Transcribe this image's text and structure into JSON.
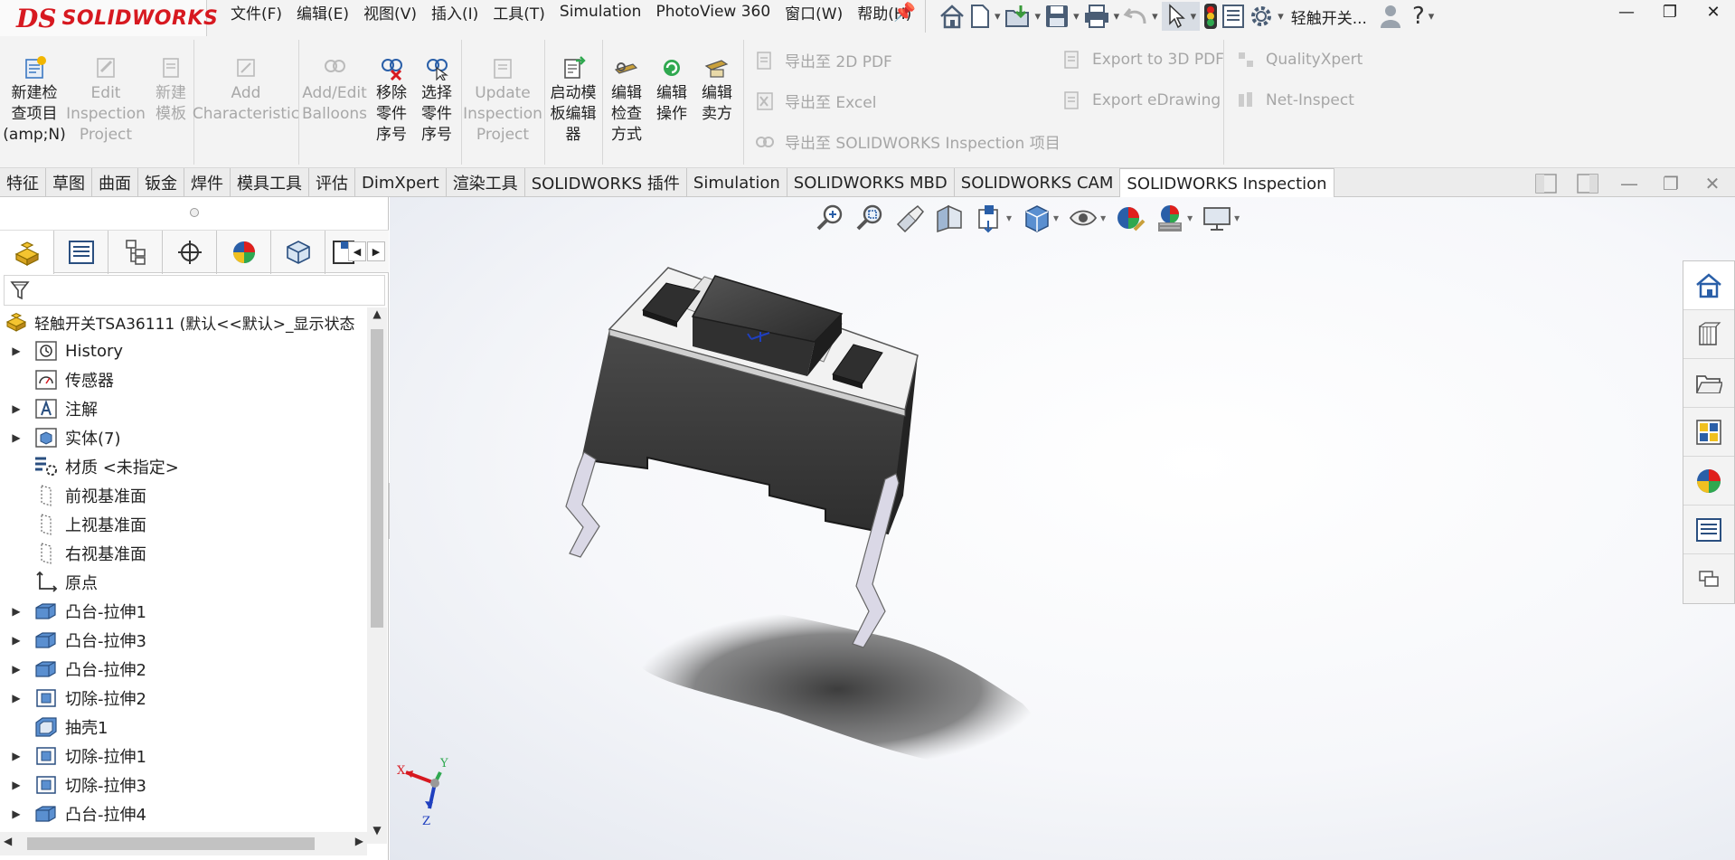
{
  "app": {
    "logo_prefix": "DS",
    "logo_text": "SOLIDWORKS"
  },
  "menu": [
    "文件(F)",
    "编辑(E)",
    "视图(V)",
    "插入(I)",
    "工具(T)",
    "Simulation",
    "PhotoView 360",
    "窗口(W)",
    "帮助(H)"
  ],
  "quick_access": {
    "doc_title": "轻触开关..."
  },
  "ribbon": {
    "buttons": [
      {
        "label": "新建检\n查项目\n(amp;N)",
        "enabled": true
      },
      {
        "label": "Edit\nInspection\nProject",
        "enabled": false
      },
      {
        "label": "新建\n模板",
        "enabled": false
      },
      {
        "label": "Add\nCharacteristic",
        "enabled": false
      },
      {
        "label": "Add/Edit\nBalloons",
        "enabled": false
      },
      {
        "label": "移除\n零件\n序号",
        "enabled": true
      },
      {
        "label": "选择\n零件\n序号",
        "enabled": true
      },
      {
        "label": "Update\nInspection\nProject",
        "enabled": false
      },
      {
        "label": "启动模\n板编辑\n器",
        "enabled": true
      },
      {
        "label": "编辑\n检查\n方式",
        "enabled": true
      },
      {
        "label": "编辑\n操作",
        "enabled": true
      },
      {
        "label": "编辑\n卖方",
        "enabled": true
      }
    ],
    "exports": [
      "导出至 2D PDF",
      "导出至 Excel",
      "导出至 SOLIDWORKS Inspection 项目",
      "Export to 3D PDF",
      "Export eDrawing",
      "QualityXpert",
      "Net-Inspect"
    ]
  },
  "tabs": {
    "items": [
      "特征",
      "草图",
      "曲面",
      "钣金",
      "焊件",
      "模具工具",
      "评估",
      "DimXpert",
      "渲染工具",
      "SOLIDWORKS 插件",
      "Simulation",
      "SOLIDWORKS MBD",
      "SOLIDWORKS CAM",
      "SOLIDWORKS Inspection"
    ],
    "active": "SOLIDWORKS Inspection"
  },
  "feature_tree": {
    "root": "轻触开关TSA36111 (默认<<默认>_显示状态",
    "nodes": [
      {
        "label": "History",
        "expandable": true,
        "icon": "history-icon"
      },
      {
        "label": "传感器",
        "expandable": false,
        "icon": "sensor-icon"
      },
      {
        "label": "注解",
        "expandable": true,
        "icon": "annotation-icon"
      },
      {
        "label": "实体(7)",
        "expandable": true,
        "icon": "solid-bodies-icon"
      },
      {
        "label": "材质 <未指定>",
        "expandable": false,
        "icon": "material-icon"
      },
      {
        "label": "前视基准面",
        "expandable": false,
        "icon": "plane-icon"
      },
      {
        "label": "上视基准面",
        "expandable": false,
        "icon": "plane-icon"
      },
      {
        "label": "右视基准面",
        "expandable": false,
        "icon": "plane-icon"
      },
      {
        "label": "原点",
        "expandable": false,
        "icon": "origin-icon"
      },
      {
        "label": "凸台-拉伸1",
        "expandable": true,
        "icon": "boss-extrude-icon"
      },
      {
        "label": "凸台-拉伸3",
        "expandable": true,
        "icon": "boss-extrude-icon"
      },
      {
        "label": "凸台-拉伸2",
        "expandable": true,
        "icon": "boss-extrude-icon"
      },
      {
        "label": "切除-拉伸2",
        "expandable": true,
        "icon": "cut-extrude-icon"
      },
      {
        "label": "抽壳1",
        "expandable": false,
        "icon": "shell-icon"
      },
      {
        "label": "切除-拉伸1",
        "expandable": true,
        "icon": "cut-extrude-icon"
      },
      {
        "label": "切除-拉伸3",
        "expandable": true,
        "icon": "cut-extrude-icon"
      },
      {
        "label": "凸台-拉伸4",
        "expandable": true,
        "icon": "boss-extrude-icon"
      }
    ]
  },
  "triad": {
    "x": "X",
    "y": "Y",
    "z": "Z"
  },
  "colors": {
    "brand": "#d71920",
    "body": "#3f3f3f",
    "top": "#f2f2f2",
    "accent": "#3b78c2"
  }
}
